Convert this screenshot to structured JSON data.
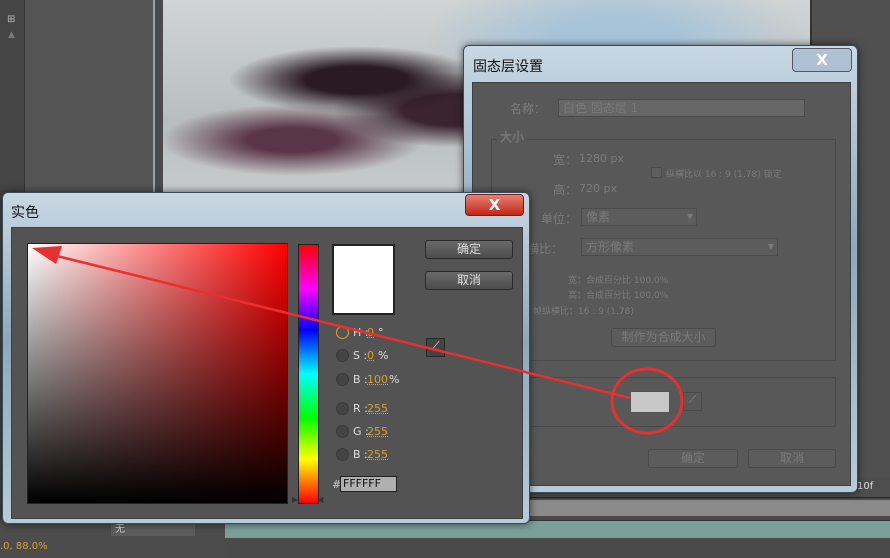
{
  "solid_settings": {
    "title": "固态层设置",
    "close": "X",
    "name_label": "名称：",
    "name_value": "白色 固态层 1",
    "size_group": "大小",
    "width_label": "宽：",
    "width_value": "1280 px",
    "height_label": "高：",
    "height_value": "720 px",
    "lock_label": "纵横比以 16 : 9 (1.78) 锁定",
    "units_label": "单位：",
    "units_value": "像素",
    "par_label": "像素纵横比：",
    "par_value": "方形像素",
    "info_width": "宽：合成百分比 100.0%",
    "info_height": "高：合成百分比 100.0%",
    "info_frame": "帧纵横比：16 : 9 (1.78)",
    "make_comp_size": "制作为合成大小",
    "swatch_color": "#c8c8c8",
    "ok": "确定",
    "cancel": "取消"
  },
  "solid_color": {
    "title": "实色",
    "close": "X",
    "ok": "确定",
    "cancel": "取消",
    "preview_color": "#FFFFFF",
    "fields": [
      {
        "label": "H :",
        "value": "0",
        "unit": "°",
        "selected": true
      },
      {
        "label": "S :",
        "value": "0",
        "unit": "%"
      },
      {
        "label": "B :",
        "value": "100",
        "unit": "%"
      },
      {
        "label": "R :",
        "value": "255",
        "unit": ""
      },
      {
        "label": "G :",
        "value": "255",
        "unit": ""
      },
      {
        "label": "B :",
        "value": "255",
        "unit": ""
      }
    ],
    "hex_label": "#",
    "hex_value": "FFFFFF",
    "hue_color": "#FF0000"
  },
  "timeline": {
    "frame_label": "10f",
    "mode_value": "无",
    "zoom_readout": ".0, 88.0%"
  },
  "annotation": {
    "color": "#e83030"
  }
}
